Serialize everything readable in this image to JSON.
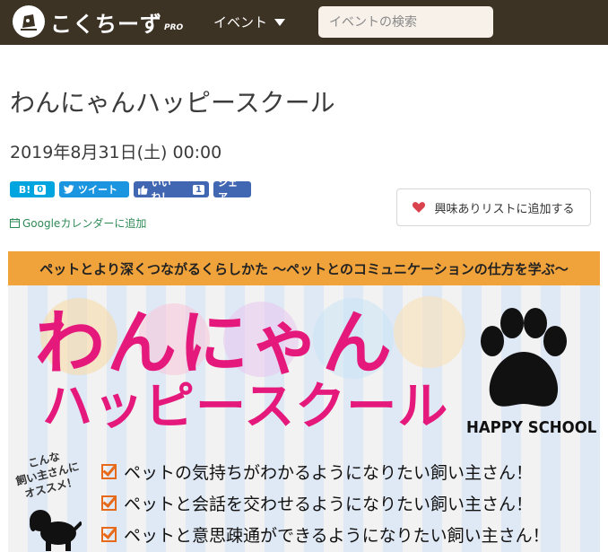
{
  "header": {
    "logo_text": "こくちーず",
    "logo_sub": "PRO",
    "nav_events": "イベント",
    "search_placeholder": "イベントの検索",
    "bg_color": "#3d3325",
    "search_button_color": "#b59b74"
  },
  "event": {
    "title": "わんにゃんハッピースクール",
    "date": "2019年8月31日(土) 00:00"
  },
  "social": {
    "hatena_label": "B!",
    "hatena_count": "0",
    "tweet_label": "ツイート",
    "like_label": "いいね！",
    "like_count": "1",
    "share_label": "シェア"
  },
  "calendar_link": "Googleカレンダーに追加",
  "interest_button": "興味ありリストに追加する",
  "banner": {
    "top_text": "ペットとより深くつながるくらしかた 〜ペットとのコミュニケーションの仕方を学ぶ〜",
    "title_line1": "わんにゃん",
    "title_line2": "ハッピースクール",
    "english": "HAPPY SCHOOL",
    "recommend": [
      "こんな",
      "飼い主さんに",
      "オススメ！"
    ],
    "checklist": [
      "ペットの気持ちがわかるようになりたい飼い主さん！",
      "ペットと会話を交わせるようになりたい飼い主さん！",
      "ペットと意思疎通ができるようになりたい飼い主さん！"
    ],
    "accent_color": "#e4197b",
    "band_color": "#f1a33b"
  }
}
